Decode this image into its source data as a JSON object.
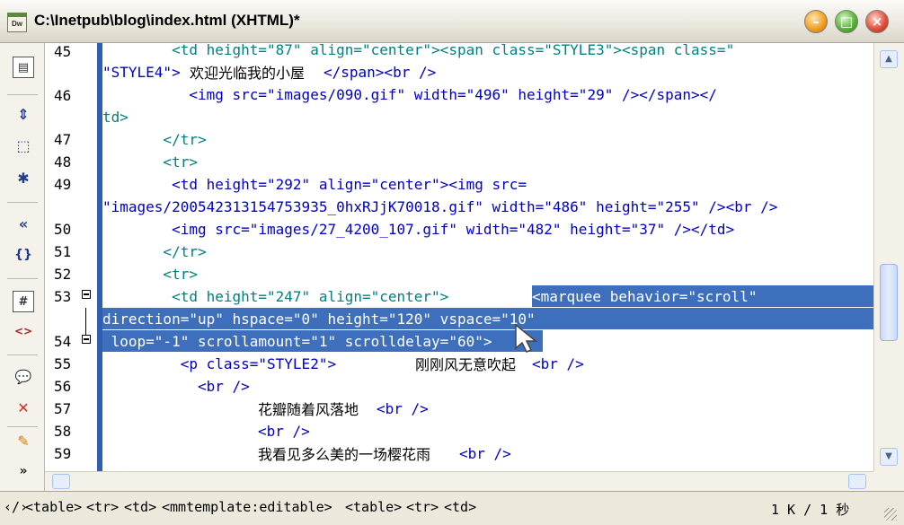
{
  "window": {
    "title": "C:\\Inetpub\\blog\\index.html (XHTML)*",
    "app_icon_label": "Dw",
    "minimize_symbol": "–",
    "maximize_symbol": "□",
    "close_symbol": "×"
  },
  "toolbar": {
    "items": [
      {
        "icon": "document-options-icon",
        "glyph": "▤"
      },
      {
        "icon": "collapse-full-tag-icon",
        "glyph": "⇕"
      },
      {
        "icon": "collapse-selection-icon",
        "glyph": "⬚"
      },
      {
        "icon": "expand-all-icon",
        "glyph": "✱"
      },
      {
        "icon": "select-parent-tag-icon",
        "glyph": "«"
      },
      {
        "icon": "balance-braces-icon",
        "glyph": "{}"
      },
      {
        "icon": "line-numbers-icon",
        "glyph": "#"
      },
      {
        "icon": "highlight-invalid-code-icon",
        "glyph": "<>"
      },
      {
        "icon": "apply-comment-icon",
        "glyph": "💬"
      },
      {
        "icon": "remove-comment-icon",
        "glyph": "✕"
      },
      {
        "icon": "wrap-tag-icon",
        "glyph": "✎"
      },
      {
        "icon": "more-icon",
        "glyph": "»"
      }
    ]
  },
  "editor": {
    "line_numbers": [
      "45",
      "46",
      "47",
      "48",
      "49",
      "50",
      "51",
      "52",
      "53",
      "54",
      "55",
      "56",
      "57",
      "58",
      "59"
    ],
    "lines": [
      {
        "t": "        <td height=\"87\" align=\"center\"><span class=\"STYLE3\"><span class=\"",
        "c": "teal"
      },
      {
        "t": "\"STYLE4\">",
        "c": ""
      },
      {
        "t": "欢迎光临我的小屋",
        "c": "txt"
      },
      {
        "t": "</span><br />",
        "c": ""
      },
      {
        "t": "          <img src=\"images/090.gif\" width=\"496\" height=\"29\" /></span></",
        "c": ""
      },
      {
        "t": "td>",
        "c": "teal"
      },
      {
        "t": "       </tr>",
        "c": "teal"
      },
      {
        "t": "       <tr>",
        "c": "teal"
      },
      {
        "t": "        <td height=\"292\" align=\"center\"><img src=",
        "c": ""
      },
      {
        "t": "\"images/200542313154753935_0hxRJjK70018.gif\" width=\"486\" height=\"255\" /><br />",
        "c": ""
      },
      {
        "t": "        <img src=\"images/27_4200_107.gif\" width=\"482\" height=\"37\" /></td>",
        "c": ""
      },
      {
        "t": "       </tr>",
        "c": "teal"
      },
      {
        "t": "       <tr>",
        "c": "teal"
      },
      {
        "t": "        <td height=\"247\" align=\"center\">",
        "c": "teal"
      },
      {
        "t": "<marquee behavior=\"scroll\"",
        "c": ""
      },
      {
        "t": "direction=\"up\" hspace=\"0\" height=\"120\" vspace=\"10\"",
        "c": ""
      },
      {
        "t": " loop=\"-1\" scrollamount=\"1\" scrolldelay=\"60\">",
        "c": ""
      },
      {
        "t": "         <p class=\"STYLE2\">",
        "c": ""
      },
      {
        "t": "刚刚风无意吹起",
        "c": "txt"
      },
      {
        "t": "<br />",
        "c": ""
      },
      {
        "t": "           <br />",
        "c": ""
      },
      {
        "t": "花瓣随着风落地",
        "c": "txt"
      },
      {
        "t": "<br />",
        "c": ""
      },
      {
        "t": "<br />",
        "c": ""
      },
      {
        "t": "我看见多么美的一场樱花雨",
        "c": "txt"
      },
      {
        "t": "<br />",
        "c": ""
      }
    ]
  },
  "status": {
    "tag_selector": [
      "‹/›",
      "<table>",
      "<tr>",
      "<td>",
      "<mmtemplate:editable>",
      "<table>",
      "<tr>",
      "<td>"
    ],
    "doc_size": "1 K / 1 秒"
  },
  "colors": {
    "selection": "#3d6fbd",
    "tag_blue": "#0000c0",
    "tag_teal": "#008080"
  }
}
